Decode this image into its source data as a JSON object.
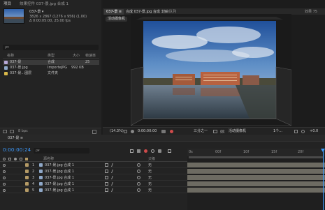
{
  "project": {
    "tab_label": "项目",
    "tab2_label": "效果控件 037-景.jpg 合成 1",
    "asset_name": "037-景 ▾",
    "asset_info_1": "3826 x 2867 (1276 x 956) (1.00)",
    "asset_info_2": "Δ 0:00:05:00, 25.00 fps",
    "search_placeholder": "ρ▾",
    "columns": {
      "name": "名称",
      "type": "类型",
      "size": "大小",
      "fps": "帧速率"
    },
    "rows": [
      {
        "name": "037-景",
        "type": "合成",
        "size": "",
        "fps": "25"
      },
      {
        "name": "037-景.jpg",
        "type": "ImporteJPG",
        "size": "992 KB",
        "fps": ""
      },
      {
        "name": "037-景...图层",
        "type": "文件夹",
        "size": "",
        "fps": ""
      }
    ],
    "footer_label": "8 bpc"
  },
  "comp": {
    "tabs": [
      {
        "label": "037-景 ≡"
      },
      {
        "label": "合成 037-景.jpg 合成 1 ≡"
      },
      {
        "label": "渲染队列"
      }
    ],
    "right_label": "效果 75",
    "crumb": "活动摄像机",
    "footer": {
      "zoom": "(14.3%)",
      "timecode": "0:00:00:00",
      "quality": "三分之一",
      "camera": "活动摄像机",
      "views": "1个...",
      "offset": "+0.0"
    }
  },
  "timeline": {
    "tab_label": "037-景 ≡",
    "timecode": "0:00:00:24",
    "search_placeholder": "ρ▾",
    "columns": {
      "source": "源名称",
      "parent": "父级"
    },
    "ruler_labels": [
      "0s",
      "00f",
      "10f",
      "15f",
      "20f"
    ],
    "layers": [
      {
        "num": "1",
        "name": "037-景.jpg 合成 1",
        "parent": "无"
      },
      {
        "num": "2",
        "name": "037-景.jpg 合成 1",
        "parent": "无"
      },
      {
        "num": "3",
        "name": "037-景.jpg 合成 1",
        "parent": "无"
      },
      {
        "num": "4",
        "name": "037-景.jpg 合成 1",
        "parent": "无"
      },
      {
        "num": "5",
        "name": "037-景.jpg 合成 1",
        "parent": "无"
      }
    ]
  },
  "colors": {
    "accent": "#3d9bff",
    "layer_label": "#b49a66",
    "layer_bar": "#6d6b62"
  }
}
